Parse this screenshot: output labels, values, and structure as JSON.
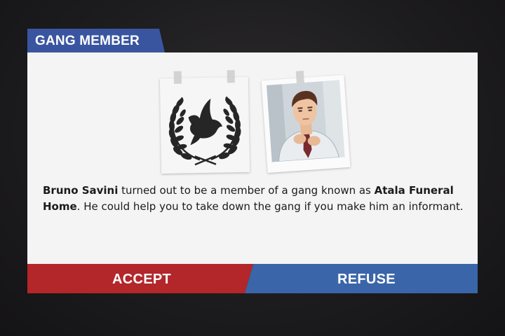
{
  "dialog": {
    "title": "GANG MEMBER",
    "message": {
      "name": "Bruno Savini",
      "mid": " turned out to be a member of a gang known as ",
      "gang": "Atala Funeral Home",
      "rest": ". He could help you to take down the gang if you make him an informant."
    },
    "accept_label": "ACCEPT",
    "refuse_label": "REFUSE",
    "emblem_icon": "dove-laurel-icon",
    "portrait": "suspect-portrait"
  },
  "colors": {
    "title_bar": "#3a55a0",
    "accept": "#b3262a",
    "refuse": "#3a65a8",
    "panel": "#f4f4f4"
  }
}
